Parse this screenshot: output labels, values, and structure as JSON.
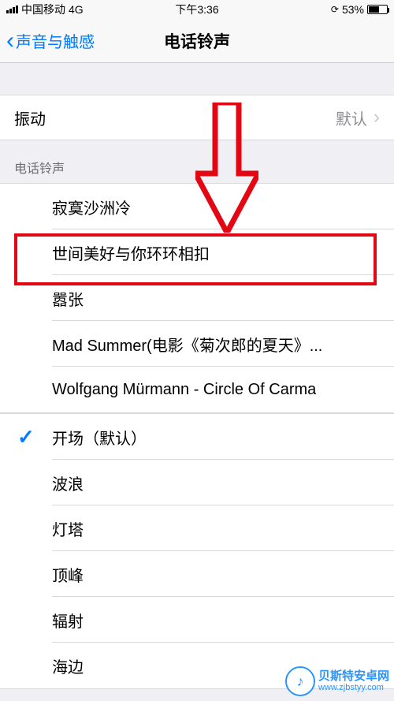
{
  "status": {
    "carrier": "中国移动",
    "network": "4G",
    "time": "下午3:36",
    "battery_pct": "53%"
  },
  "nav": {
    "back_label": "声音与触感",
    "title": "电话铃声"
  },
  "vibration": {
    "label": "振动",
    "value": "默认"
  },
  "sections": {
    "ringtones_header": "电话铃声"
  },
  "custom_tones": [
    "寂寞沙洲冷",
    "世间美好与你环环相扣",
    "嚣张",
    "Mad Summer(电影《菊次郎的夏天》...",
    "Wolfgang Mürmann - Circle Of Carma"
  ],
  "system_tones": [
    {
      "label": "开场（默认）",
      "selected": true
    },
    {
      "label": "波浪",
      "selected": false
    },
    {
      "label": "灯塔",
      "selected": false
    },
    {
      "label": "顶峰",
      "selected": false
    },
    {
      "label": "辐射",
      "selected": false
    },
    {
      "label": "海边",
      "selected": false
    }
  ],
  "watermark": {
    "title": "贝斯特安卓网",
    "url": "www.zjbstyy.com"
  }
}
